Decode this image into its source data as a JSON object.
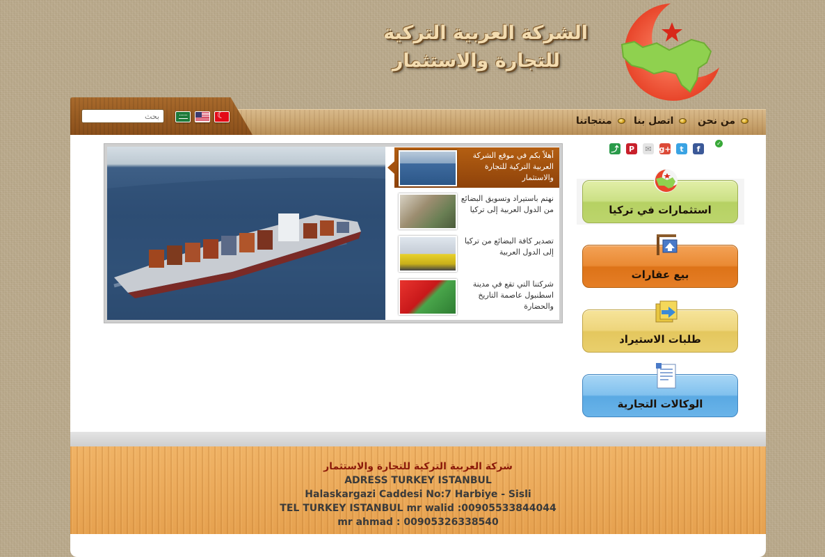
{
  "header": {
    "company_name_line1": "الشركة العربية التركية",
    "company_name_line2": "للتجارة والاستثمار"
  },
  "nav": {
    "items": [
      {
        "label": "من نحن"
      },
      {
        "label": "اتصل بنا"
      },
      {
        "label": "منتجاتنا"
      }
    ],
    "search_placeholder": "بحث",
    "flags": [
      "saudi-flag-icon",
      "us-flag-icon",
      "turkey-flag-icon"
    ]
  },
  "slider": {
    "items": [
      {
        "text": "أهلاً بكم في موقع الشركة العربية التركية للتجارة والاستثمار",
        "active": true
      },
      {
        "text": "نهتم باستيراد وتسويق البضائع من الدول العربية إلى تركيا",
        "active": false
      },
      {
        "text": "تصدير كافة البضائع من تركيا إلى الدول العربية",
        "active": false
      },
      {
        "text": "شركتنا التي تقع في مدينة اسطنبول عاصمة التاريخ والحضارة",
        "active": false
      }
    ]
  },
  "share": {
    "icons": [
      "facebook-icon",
      "twitter-icon",
      "google-plus-icon",
      "email-icon",
      "pinterest-icon",
      "share-icon"
    ]
  },
  "side_buttons": {
    "investments": "استثمارات في تركيا",
    "real_estate": "بيع عقارات",
    "import_requests": "طلبات الاستيراد",
    "agencies": "الوكالات التجارية"
  },
  "footer": {
    "company": "شركة العربية التركية للتجارة والاستثمار",
    "address_title": "ADRESS TURKEY ISTANBUL",
    "street": "Halaskargazi Caddesi No:7 Harbiye - Sisli",
    "tel": "TEL TURKEY ISTANBUL mr walid :00905533844044",
    "tel2": "mr ahmad : 00905326338540"
  },
  "colors": {
    "accent_brown": "#8e420a",
    "footer_orange": "#e6a14f",
    "footer_title": "#8b1a0a"
  }
}
